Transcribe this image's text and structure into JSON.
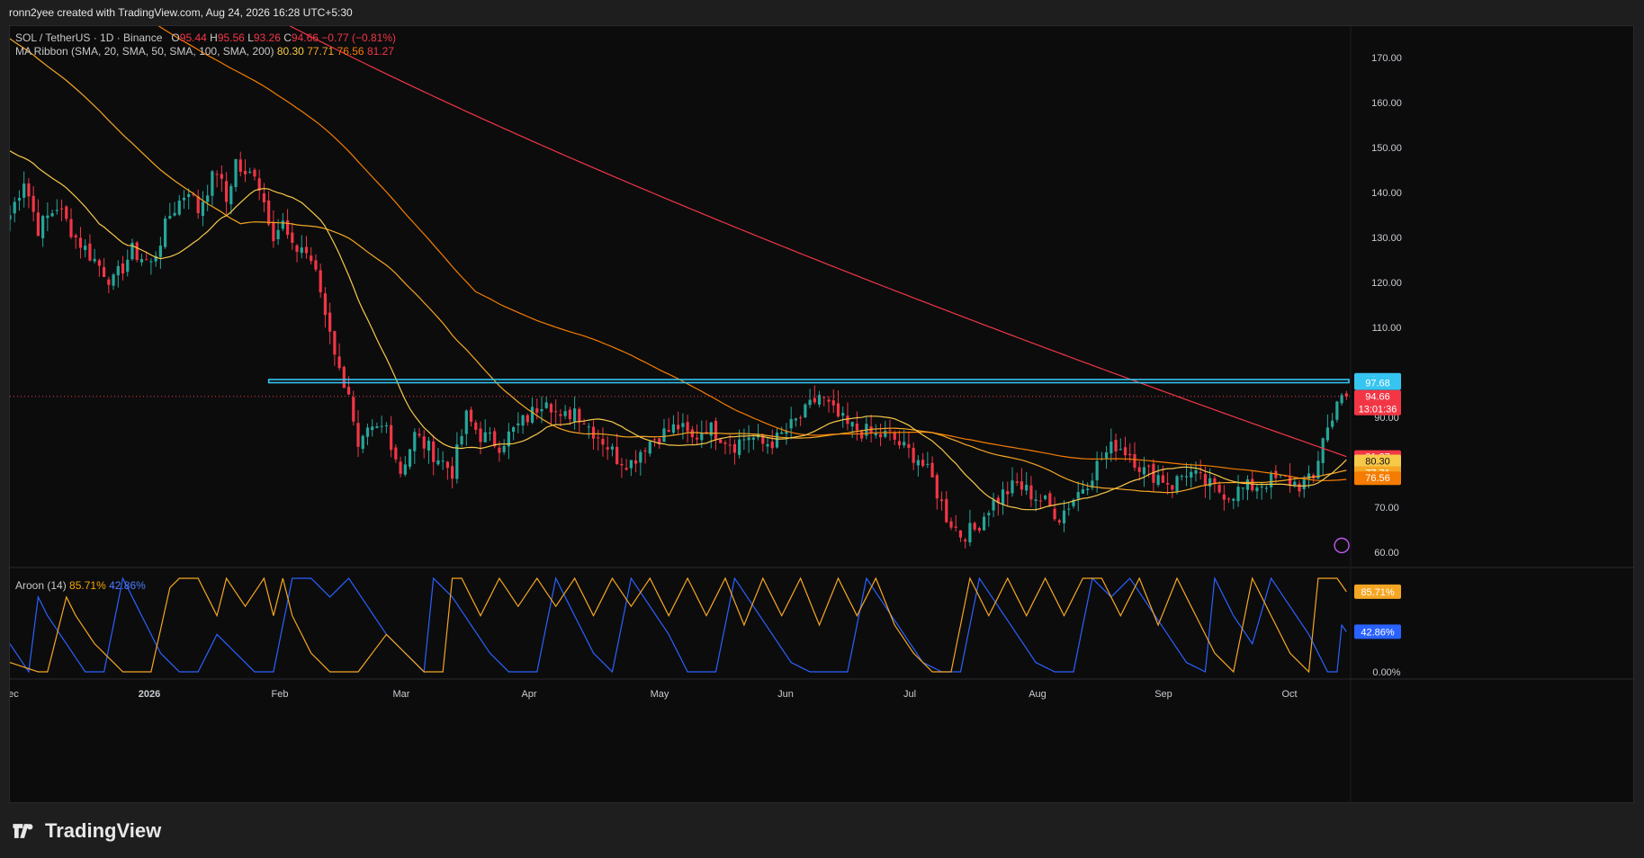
{
  "header": {
    "credit": "ronn2yee created with TradingView.com, Aug 24, 2026 16:28 UTC+5:30"
  },
  "legend": {
    "symbol": "SOL / TetherUS · 1D · Binance",
    "ohlc": {
      "o_label": "O",
      "o": "95.44",
      "h_label": "H",
      "h": "95.56",
      "l_label": "L",
      "l": "93.26",
      "c_label": "C",
      "c": "94.66",
      "chg": "−0.77 (−0.81%)"
    },
    "ma_label": "MA Ribbon (SMA, 20, SMA, 50, SMA, 100, SMA, 200)",
    "ma_values": [
      "80.30",
      "77.71",
      "76.56",
      "81.27"
    ],
    "aroon_label": "Aroon (14)",
    "aroon_values": [
      "85.71%",
      "42.86%"
    ]
  },
  "brand": {
    "name": "TradingView"
  },
  "colors": {
    "up": "#26a69a",
    "down": "#f23645",
    "ma20": "#f7c948",
    "ma50": "#f5a623",
    "ma100": "#f57c00",
    "ma200": "#f23645",
    "resistance": "#36c5f0",
    "aroon_up": "#f5a623",
    "aroon_down": "#2962ff"
  },
  "chart_data": {
    "type": "candlestick",
    "title": "SOL / TetherUS · 1D · Binance",
    "x_ticks": [
      "Dec",
      "2026",
      "Feb",
      "Mar",
      "Apr",
      "May",
      "Jun",
      "Jul",
      "Aug",
      "Sep",
      "Oct"
    ],
    "y_ticks": [
      "170.00",
      "160.00",
      "150.00",
      "140.00",
      "130.00",
      "120.00",
      "110.00",
      "90.00",
      "70.00",
      "60.00"
    ],
    "ylim": [
      57,
      177
    ],
    "price_labels": [
      {
        "value": 98.44,
        "text": "98.44",
        "color": "#36c5f0"
      },
      {
        "value": 97.68,
        "text": "97.68",
        "color": "#36c5f0"
      },
      {
        "value": 94.66,
        "text": "94.66",
        "sub": "13:01:36",
        "color": "#f23645"
      },
      {
        "value": 81.27,
        "text": "81.27",
        "color": "#f23645"
      },
      {
        "value": 80.3,
        "text": "80.30",
        "color": "#f7c948"
      },
      {
        "value": 77.71,
        "text": "77.71",
        "color": "#f5a623"
      },
      {
        "value": 76.56,
        "text": "76.56",
        "color": "#f57c00"
      }
    ],
    "resistance": [
      97.7,
      98.4
    ],
    "last_close": 94.66,
    "price_waypoints": [
      [
        0,
        135
      ],
      [
        3,
        143
      ],
      [
        6,
        132
      ],
      [
        10,
        137
      ],
      [
        14,
        130
      ],
      [
        18,
        125
      ],
      [
        22,
        120
      ],
      [
        26,
        127
      ],
      [
        30,
        124
      ],
      [
        34,
        135
      ],
      [
        38,
        141
      ],
      [
        40,
        136
      ],
      [
        42,
        141
      ],
      [
        44,
        145
      ],
      [
        46,
        138
      ],
      [
        48,
        147
      ],
      [
        50,
        143
      ],
      [
        52,
        145
      ],
      [
        54,
        138
      ],
      [
        56,
        131
      ],
      [
        58,
        133
      ],
      [
        60,
        127
      ],
      [
        62,
        128
      ],
      [
        64,
        125
      ],
      [
        66,
        118
      ],
      [
        67,
        113
      ],
      [
        68,
        110
      ],
      [
        70,
        100
      ],
      [
        72,
        96
      ],
      [
        73,
        88
      ],
      [
        74,
        82
      ],
      [
        76,
        86
      ],
      [
        80,
        88
      ],
      [
        83,
        78
      ],
      [
        86,
        86
      ],
      [
        90,
        82
      ],
      [
        94,
        78
      ],
      [
        97,
        90
      ],
      [
        100,
        86
      ],
      [
        104,
        84
      ],
      [
        108,
        88
      ],
      [
        111,
        91
      ],
      [
        114,
        95
      ],
      [
        117,
        89
      ],
      [
        120,
        92
      ],
      [
        123,
        88
      ],
      [
        126,
        85
      ],
      [
        129,
        81
      ],
      [
        132,
        80
      ],
      [
        135,
        84
      ],
      [
        138,
        86
      ],
      [
        142,
        88
      ],
      [
        145,
        85
      ],
      [
        148,
        88
      ],
      [
        151,
        86
      ],
      [
        154,
        84
      ],
      [
        157,
        86
      ],
      [
        160,
        84
      ],
      [
        163,
        85
      ],
      [
        166,
        88
      ],
      [
        169,
        91
      ],
      [
        172,
        95
      ],
      [
        175,
        91
      ],
      [
        178,
        88
      ],
      [
        181,
        87
      ],
      [
        184,
        86
      ],
      [
        187,
        86
      ],
      [
        190,
        83
      ],
      [
        193,
        81
      ],
      [
        196,
        76
      ],
      [
        199,
        68
      ],
      [
        202,
        64
      ],
      [
        205,
        65
      ],
      [
        208,
        70
      ],
      [
        211,
        73
      ],
      [
        214,
        75
      ],
      [
        217,
        73
      ],
      [
        220,
        71
      ],
      [
        223,
        68
      ],
      [
        226,
        72
      ],
      [
        229,
        76
      ],
      [
        232,
        81
      ],
      [
        235,
        84
      ],
      [
        238,
        82
      ],
      [
        241,
        78
      ],
      [
        244,
        77
      ],
      [
        247,
        75
      ],
      [
        250,
        78
      ],
      [
        253,
        76
      ],
      [
        256,
        74
      ],
      [
        259,
        73
      ],
      [
        262,
        74
      ],
      [
        265,
        75
      ],
      [
        268,
        76
      ],
      [
        271,
        76
      ],
      [
        274,
        75
      ],
      [
        277,
        76
      ],
      [
        279,
        86
      ],
      [
        281,
        89
      ],
      [
        282,
        95
      ],
      [
        283,
        95.4
      ],
      [
        284,
        94.66
      ]
    ],
    "aroon_up_waypoints": [
      [
        0,
        10
      ],
      [
        6,
        0
      ],
      [
        8,
        0
      ],
      [
        12,
        80
      ],
      [
        14,
        60
      ],
      [
        18,
        30
      ],
      [
        24,
        0
      ],
      [
        30,
        0
      ],
      [
        34,
        90
      ],
      [
        36,
        100
      ],
      [
        40,
        100
      ],
      [
        44,
        60
      ],
      [
        46,
        100
      ],
      [
        50,
        70
      ],
      [
        54,
        100
      ],
      [
        56,
        60
      ],
      [
        58,
        100
      ],
      [
        60,
        60
      ],
      [
        64,
        20
      ],
      [
        68,
        0
      ],
      [
        74,
        0
      ],
      [
        80,
        40
      ],
      [
        84,
        20
      ],
      [
        88,
        0
      ],
      [
        92,
        0
      ],
      [
        94,
        100
      ],
      [
        96,
        100
      ],
      [
        100,
        60
      ],
      [
        104,
        100
      ],
      [
        108,
        70
      ],
      [
        112,
        100
      ],
      [
        116,
        70
      ],
      [
        120,
        100
      ],
      [
        124,
        60
      ],
      [
        128,
        100
      ],
      [
        132,
        70
      ],
      [
        136,
        100
      ],
      [
        140,
        60
      ],
      [
        144,
        100
      ],
      [
        148,
        60
      ],
      [
        152,
        100
      ],
      [
        156,
        50
      ],
      [
        160,
        100
      ],
      [
        164,
        60
      ],
      [
        168,
        100
      ],
      [
        172,
        50
      ],
      [
        176,
        100
      ],
      [
        180,
        60
      ],
      [
        184,
        100
      ],
      [
        188,
        50
      ],
      [
        192,
        20
      ],
      [
        196,
        0
      ],
      [
        200,
        0
      ],
      [
        204,
        100
      ],
      [
        208,
        60
      ],
      [
        212,
        100
      ],
      [
        216,
        60
      ],
      [
        220,
        100
      ],
      [
        224,
        60
      ],
      [
        228,
        100
      ],
      [
        232,
        100
      ],
      [
        236,
        60
      ],
      [
        240,
        100
      ],
      [
        244,
        50
      ],
      [
        248,
        100
      ],
      [
        252,
        60
      ],
      [
        256,
        20
      ],
      [
        260,
        0
      ],
      [
        264,
        100
      ],
      [
        268,
        60
      ],
      [
        272,
        20
      ],
      [
        276,
        0
      ],
      [
        278,
        100
      ],
      [
        282,
        100
      ],
      [
        284,
        85.71
      ]
    ],
    "aroon_down_waypoints": [
      [
        0,
        30
      ],
      [
        4,
        0
      ],
      [
        6,
        80
      ],
      [
        8,
        60
      ],
      [
        12,
        30
      ],
      [
        16,
        0
      ],
      [
        20,
        0
      ],
      [
        24,
        100
      ],
      [
        28,
        60
      ],
      [
        32,
        20
      ],
      [
        36,
        0
      ],
      [
        40,
        0
      ],
      [
        44,
        40
      ],
      [
        48,
        20
      ],
      [
        52,
        0
      ],
      [
        56,
        0
      ],
      [
        60,
        100
      ],
      [
        64,
        100
      ],
      [
        68,
        80
      ],
      [
        72,
        100
      ],
      [
        76,
        70
      ],
      [
        80,
        40
      ],
      [
        84,
        20
      ],
      [
        88,
        0
      ],
      [
        90,
        100
      ],
      [
        94,
        80
      ],
      [
        98,
        50
      ],
      [
        102,
        20
      ],
      [
        106,
        0
      ],
      [
        112,
        0
      ],
      [
        116,
        100
      ],
      [
        120,
        60
      ],
      [
        124,
        20
      ],
      [
        128,
        0
      ],
      [
        132,
        100
      ],
      [
        136,
        70
      ],
      [
        140,
        40
      ],
      [
        144,
        0
      ],
      [
        150,
        0
      ],
      [
        154,
        100
      ],
      [
        158,
        70
      ],
      [
        162,
        40
      ],
      [
        166,
        10
      ],
      [
        170,
        0
      ],
      [
        178,
        0
      ],
      [
        182,
        100
      ],
      [
        186,
        70
      ],
      [
        190,
        40
      ],
      [
        194,
        10
      ],
      [
        198,
        0
      ],
      [
        202,
        0
      ],
      [
        206,
        100
      ],
      [
        210,
        70
      ],
      [
        214,
        40
      ],
      [
        218,
        10
      ],
      [
        222,
        0
      ],
      [
        226,
        0
      ],
      [
        230,
        100
      ],
      [
        234,
        80
      ],
      [
        238,
        100
      ],
      [
        242,
        70
      ],
      [
        246,
        40
      ],
      [
        250,
        10
      ],
      [
        254,
        0
      ],
      [
        256,
        100
      ],
      [
        260,
        60
      ],
      [
        264,
        30
      ],
      [
        268,
        100
      ],
      [
        272,
        70
      ],
      [
        276,
        40
      ],
      [
        280,
        0
      ],
      [
        282,
        0
      ],
      [
        283,
        50
      ],
      [
        284,
        42.86
      ]
    ]
  }
}
